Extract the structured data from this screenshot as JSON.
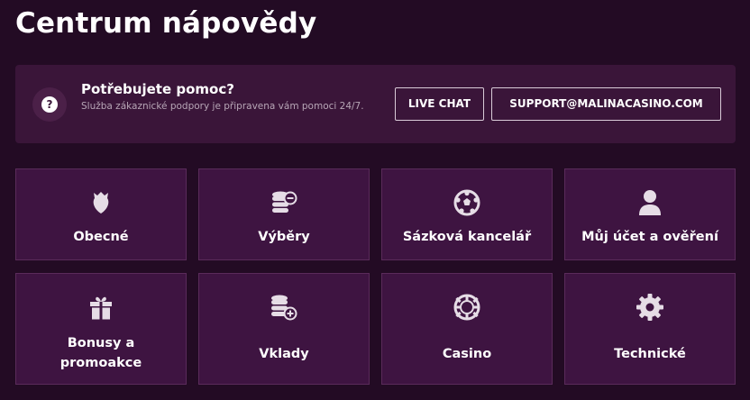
{
  "page": {
    "title": "Centrum nápovědy"
  },
  "help_banner": {
    "heading": "Potřebujete pomoc?",
    "description": "Služba zákaznické podpory je připravena vám pomoci 24/7.",
    "icon": "question-icon",
    "live_chat_label": "LIVE CHAT",
    "email_label": "SUPPORT@MALINACASINO.COM"
  },
  "categories": [
    {
      "label": "Obecné",
      "icon": "raspberry-icon"
    },
    {
      "label": "Výběry",
      "icon": "coins-minus-icon"
    },
    {
      "label": "Sázková kancelář",
      "icon": "soccer-ball-icon"
    },
    {
      "label": "Můj účet a ověření",
      "icon": "user-icon"
    },
    {
      "label": "Bonusy a promoakce",
      "icon": "gift-icon"
    },
    {
      "label": "Vklady",
      "icon": "coins-plus-icon"
    },
    {
      "label": "Casino",
      "icon": "casino-chip-icon"
    },
    {
      "label": "Technické",
      "icon": "gear-icon"
    }
  ],
  "colors": {
    "background": "#230b24",
    "banner": "#3a1539",
    "tile": "#3e1441",
    "tile_border": "#5a2b5a",
    "text": "#ffffff",
    "muted_text": "#b7a6b6"
  }
}
